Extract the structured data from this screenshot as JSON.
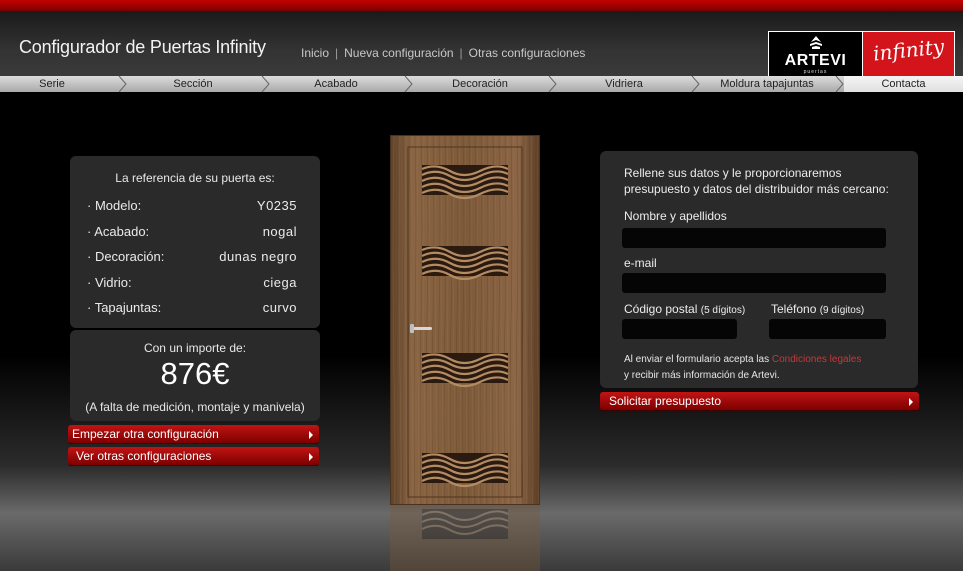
{
  "header": {
    "title": "Configurador de Puertas Infinity",
    "nav": [
      {
        "label": "Inicio"
      },
      {
        "label": "Nueva configuración"
      },
      {
        "label": "Otras configuraciones"
      }
    ],
    "nav_separator": "|",
    "logos": {
      "artevi": "ARTEVI",
      "artevi_sub": "puertas",
      "infinity": "infinity"
    }
  },
  "steps": [
    {
      "label": "Serie"
    },
    {
      "label": "Sección"
    },
    {
      "label": "Acabado"
    },
    {
      "label": "Decoración"
    },
    {
      "label": "Vidriera"
    },
    {
      "label": "Moldura tapajuntas"
    },
    {
      "label": "Contacta",
      "active": true
    }
  ],
  "reference": {
    "title": "La referencia de su puerta es:",
    "rows": [
      {
        "key": "· Modelo:",
        "value": "Y0235"
      },
      {
        "key": "· Acabado:",
        "value": "nogal"
      },
      {
        "key": "· Decoración:",
        "value": "dunas negro"
      },
      {
        "key": "· Vidrio:",
        "value": "ciega"
      },
      {
        "key": "· Tapajuntas:",
        "value": "curvo"
      }
    ]
  },
  "price": {
    "label": "Con un importe de:",
    "value": "876€",
    "note": "(A falta de medición, montaje y manivela)"
  },
  "actions": {
    "new_config": "Empezar otra configuración",
    "view_configs": "Ver otras configuraciones"
  },
  "form": {
    "intro": "Rellene sus datos y le proporcionaremos presupuesto y datos del distribuidor más cercano:",
    "name_label": "Nombre y apellidos",
    "email_label": "e-mail",
    "postal_label": "Código postal",
    "postal_hint": "(5 dígitos)",
    "phone_label": "Teléfono",
    "phone_hint": "(9 dígitos)",
    "name_value": "",
    "email_value": "",
    "postal_value": "",
    "phone_value": "",
    "legal_prefix": "Al enviar el formulario acepta las",
    "legal_link": "Condiciones legales",
    "legal_suffix": "y recibir más información de Artevi.",
    "submit_label": "Solicitar presupuesto"
  },
  "colors": {
    "accent_red": "#c11414",
    "panel_bg": "#2a2a2a",
    "door_wood": "#7a5a3c"
  }
}
